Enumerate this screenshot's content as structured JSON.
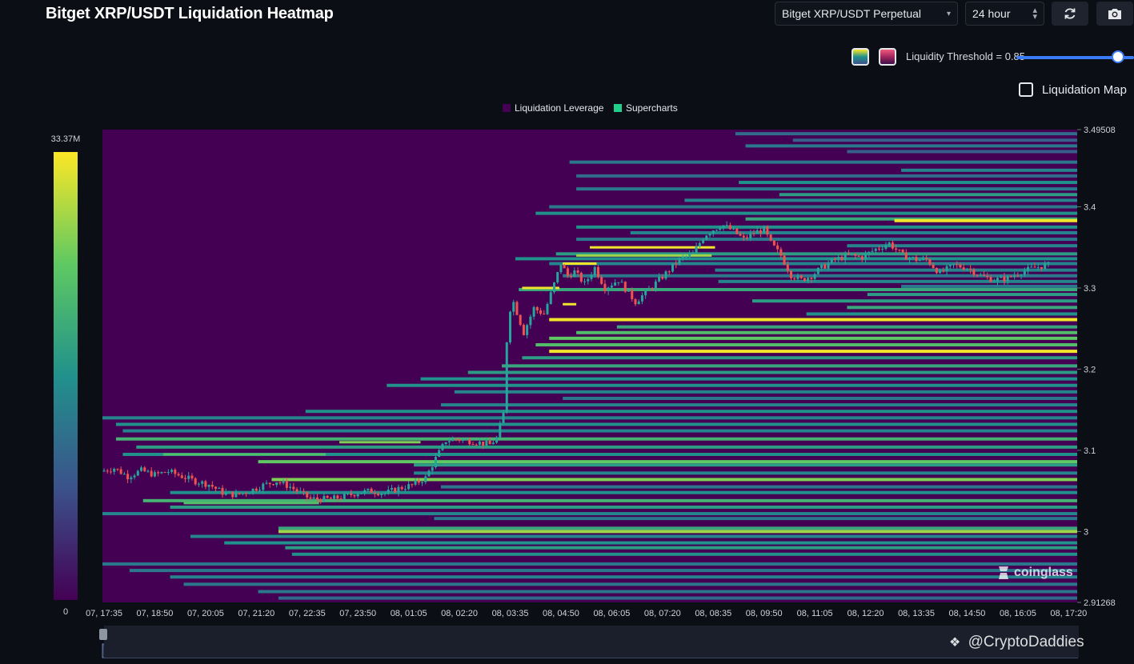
{
  "header": {
    "title": "Bitget XRP/USDT Liquidation Heatmap",
    "pair_select": "Bitget XRP/USDT Perpetual",
    "range_select": "24 hour",
    "threshold_label": "Liquidity Threshold = 0.85",
    "liquidation_map_label": "Liquidation Map"
  },
  "icons": {
    "refresh": "refresh-icon",
    "camera": "camera-icon",
    "dropdown": "chevron-down-icon",
    "stepper": "updown-icon"
  },
  "legend": {
    "leverage": "Liquidation Leverage",
    "supercharts": "Supercharts"
  },
  "colorbar": {
    "max_label": "33.37M",
    "min_label": "0"
  },
  "watermark": "coinglass",
  "credit": "@CryptoDaddies",
  "colors": {
    "background": "#0b0e14",
    "heat_low": "#440154",
    "heat_mid": "#21918c",
    "heat_high": "#fde725",
    "candle_up": "#26a69a",
    "candle_down": "#ef5350",
    "slider": "#3b7bf6"
  },
  "chart_data": {
    "type": "heatmap",
    "title": "Bitget XRP/USDT Liquidation Heatmap",
    "y_ticks": [
      "3.49508",
      "3.4",
      "3.3",
      "3.2",
      "3.1",
      "3",
      "2.91268"
    ],
    "y_tick_values": [
      3.49508,
      3.4,
      3.3,
      3.2,
      3.1,
      3.0,
      2.91268
    ],
    "ylim": [
      2.91268,
      3.49508
    ],
    "x_ticks": [
      "07, 17:35",
      "07, 18:50",
      "07, 20:05",
      "07, 21:20",
      "07, 22:35",
      "07, 23:50",
      "08, 01:05",
      "08, 02:20",
      "08, 03:35",
      "08, 04:50",
      "08, 06:05",
      "08, 07:20",
      "08, 08:35",
      "08, 09:50",
      "08, 11:05",
      "08, 12:20",
      "08, 13:35",
      "08, 14:50",
      "08, 16:05",
      "08, 17:20"
    ],
    "x_minutes": [
      0,
      75,
      150,
      225,
      300,
      375,
      450,
      525,
      600,
      675,
      750,
      825,
      900,
      975,
      1050,
      1125,
      1200,
      1275,
      1350,
      1425
    ],
    "xlim_minutes": [
      0,
      1440
    ],
    "colorbar_range": [
      0,
      33.37
    ],
    "colorbar_unit": "M",
    "price_path": [
      [
        0,
        3.074
      ],
      [
        20,
        3.078
      ],
      [
        40,
        3.068
      ],
      [
        60,
        3.075
      ],
      [
        80,
        3.07
      ],
      [
        100,
        3.074
      ],
      [
        120,
        3.068
      ],
      [
        140,
        3.062
      ],
      [
        160,
        3.058
      ],
      [
        180,
        3.048
      ],
      [
        200,
        3.045
      ],
      [
        220,
        3.05
      ],
      [
        240,
        3.057
      ],
      [
        260,
        3.062
      ],
      [
        280,
        3.055
      ],
      [
        300,
        3.045
      ],
      [
        310,
        3.04
      ],
      [
        320,
        3.04
      ],
      [
        340,
        3.04
      ],
      [
        360,
        3.043
      ],
      [
        380,
        3.048
      ],
      [
        400,
        3.05
      ],
      [
        420,
        3.047
      ],
      [
        440,
        3.053
      ],
      [
        460,
        3.057
      ],
      [
        480,
        3.066
      ],
      [
        495,
        3.09
      ],
      [
        510,
        3.112
      ],
      [
        525,
        3.114
      ],
      [
        550,
        3.111
      ],
      [
        575,
        3.107
      ],
      [
        585,
        3.115
      ],
      [
        595,
        3.145
      ],
      [
        600,
        3.235
      ],
      [
        607,
        3.29
      ],
      [
        615,
        3.27
      ],
      [
        625,
        3.245
      ],
      [
        640,
        3.275
      ],
      [
        655,
        3.268
      ],
      [
        668,
        3.3
      ],
      [
        680,
        3.33
      ],
      [
        690,
        3.315
      ],
      [
        700,
        3.32
      ],
      [
        715,
        3.305
      ],
      [
        730,
        3.325
      ],
      [
        745,
        3.3
      ],
      [
        765,
        3.31
      ],
      [
        790,
        3.283
      ],
      [
        810,
        3.298
      ],
      [
        835,
        3.318
      ],
      [
        855,
        3.335
      ],
      [
        875,
        3.342
      ],
      [
        892,
        3.365
      ],
      [
        905,
        3.372
      ],
      [
        918,
        3.378
      ],
      [
        935,
        3.37
      ],
      [
        950,
        3.36
      ],
      [
        965,
        3.368
      ],
      [
        980,
        3.372
      ],
      [
        990,
        3.355
      ],
      [
        1005,
        3.34
      ],
      [
        1020,
        3.316
      ],
      [
        1035,
        3.31
      ],
      [
        1050,
        3.315
      ],
      [
        1065,
        3.325
      ],
      [
        1085,
        3.335
      ],
      [
        1105,
        3.34
      ],
      [
        1125,
        3.338
      ],
      [
        1145,
        3.348
      ],
      [
        1165,
        3.355
      ],
      [
        1185,
        3.34
      ],
      [
        1205,
        3.335
      ],
      [
        1220,
        3.335
      ],
      [
        1240,
        3.318
      ],
      [
        1260,
        3.328
      ],
      [
        1280,
        3.325
      ],
      [
        1300,
        3.315
      ],
      [
        1320,
        3.31
      ],
      [
        1340,
        3.312
      ],
      [
        1360,
        3.32
      ],
      [
        1380,
        3.325
      ],
      [
        1395,
        3.328
      ]
    ],
    "liquidation_bands": [
      {
        "price": 3.49,
        "start": 935,
        "intensity": 0.35
      },
      {
        "price": 3.482,
        "start": 1020,
        "intensity": 0.3
      },
      {
        "price": 3.475,
        "start": 950,
        "intensity": 0.4
      },
      {
        "price": 3.468,
        "start": 1100,
        "intensity": 0.3
      },
      {
        "price": 3.455,
        "start": 690,
        "intensity": 0.4
      },
      {
        "price": 3.445,
        "start": 1180,
        "intensity": 0.45
      },
      {
        "price": 3.438,
        "start": 700,
        "intensity": 0.35
      },
      {
        "price": 3.43,
        "start": 940,
        "intensity": 0.5
      },
      {
        "price": 3.422,
        "start": 700,
        "intensity": 0.4
      },
      {
        "price": 3.415,
        "start": 1000,
        "intensity": 0.55
      },
      {
        "price": 3.408,
        "start": 860,
        "intensity": 0.45
      },
      {
        "price": 3.4,
        "start": 660,
        "intensity": 0.4
      },
      {
        "price": 3.392,
        "start": 640,
        "intensity": 0.5
      },
      {
        "price": 3.385,
        "start": 950,
        "intensity": 0.6
      },
      {
        "price": 3.383,
        "start": 1170,
        "intensity": 0.98
      },
      {
        "price": 3.375,
        "start": 700,
        "intensity": 0.5
      },
      {
        "price": 3.368,
        "start": 780,
        "intensity": 0.45
      },
      {
        "price": 3.36,
        "start": 700,
        "intensity": 0.4
      },
      {
        "price": 3.352,
        "start": 1100,
        "intensity": 0.45
      },
      {
        "price": 3.342,
        "start": 670,
        "intensity": 0.55
      },
      {
        "price": 3.336,
        "start": 610,
        "intensity": 0.5
      },
      {
        "price": 3.33,
        "start": 660,
        "intensity": 0.45
      },
      {
        "price": 3.322,
        "start": 905,
        "intensity": 0.45
      },
      {
        "price": 3.315,
        "start": 680,
        "intensity": 0.4
      },
      {
        "price": 3.308,
        "start": 910,
        "intensity": 0.45
      },
      {
        "price": 3.302,
        "start": 1180,
        "intensity": 0.4
      },
      {
        "price": 3.298,
        "start": 615,
        "intensity": 0.6
      },
      {
        "price": 3.292,
        "start": 1130,
        "intensity": 0.55
      },
      {
        "price": 3.284,
        "start": 960,
        "intensity": 0.55
      },
      {
        "price": 3.276,
        "start": 1100,
        "intensity": 0.6
      },
      {
        "price": 3.268,
        "start": 1040,
        "intensity": 0.5
      },
      {
        "price": 3.261,
        "start": 660,
        "intensity": 0.98
      },
      {
        "price": 3.252,
        "start": 760,
        "intensity": 0.6
      },
      {
        "price": 3.245,
        "start": 700,
        "intensity": 0.7
      },
      {
        "price": 3.238,
        "start": 660,
        "intensity": 0.75
      },
      {
        "price": 3.23,
        "start": 640,
        "intensity": 0.7
      },
      {
        "price": 3.222,
        "start": 660,
        "intensity": 0.98
      },
      {
        "price": 3.214,
        "start": 620,
        "intensity": 0.55
      },
      {
        "price": 3.204,
        "start": 590,
        "intensity": 0.6
      },
      {
        "price": 3.196,
        "start": 540,
        "intensity": 0.55
      },
      {
        "price": 3.188,
        "start": 470,
        "intensity": 0.5
      },
      {
        "price": 3.18,
        "start": 420,
        "intensity": 0.5
      },
      {
        "price": 3.172,
        "start": 520,
        "intensity": 0.45
      },
      {
        "price": 3.164,
        "start": 680,
        "intensity": 0.4
      },
      {
        "price": 3.156,
        "start": 500,
        "intensity": 0.45
      },
      {
        "price": 3.148,
        "start": 300,
        "intensity": 0.5
      },
      {
        "price": 3.14,
        "start": 0,
        "intensity": 0.45
      },
      {
        "price": 3.132,
        "start": 20,
        "intensity": 0.5
      },
      {
        "price": 3.124,
        "start": 30,
        "intensity": 0.45
      },
      {
        "price": 3.114,
        "start": 20,
        "intensity": 0.65
      },
      {
        "price": 3.104,
        "start": 50,
        "intensity": 0.55
      },
      {
        "price": 3.095,
        "start": 30,
        "intensity": 0.5
      },
      {
        "price": 3.086,
        "start": 230,
        "intensity": 0.75
      },
      {
        "price": 3.082,
        "start": 460,
        "intensity": 0.55
      },
      {
        "price": 3.072,
        "start": 460,
        "intensity": 0.45
      },
      {
        "price": 3.064,
        "start": 250,
        "intensity": 0.8
      },
      {
        "price": 3.055,
        "start": 500,
        "intensity": 0.4
      },
      {
        "price": 3.048,
        "start": 100,
        "intensity": 0.5
      },
      {
        "price": 3.038,
        "start": 60,
        "intensity": 0.65
      },
      {
        "price": 3.03,
        "start": 100,
        "intensity": 0.55
      },
      {
        "price": 3.022,
        "start": 0,
        "intensity": 0.45
      },
      {
        "price": 3.016,
        "start": 490,
        "intensity": 0.4
      },
      {
        "price": 3.004,
        "start": 260,
        "intensity": 0.6
      },
      {
        "price": 3.0,
        "start": 260,
        "intensity": 0.85
      },
      {
        "price": 2.994,
        "start": 130,
        "intensity": 0.45
      },
      {
        "price": 2.986,
        "start": 180,
        "intensity": 0.5
      },
      {
        "price": 2.98,
        "start": 270,
        "intensity": 0.55
      },
      {
        "price": 2.972,
        "start": 280,
        "intensity": 0.5
      },
      {
        "price": 2.96,
        "start": 0,
        "intensity": 0.4
      },
      {
        "price": 2.952,
        "start": 40,
        "intensity": 0.4
      },
      {
        "price": 2.944,
        "start": 100,
        "intensity": 0.45
      },
      {
        "price": 2.935,
        "start": 120,
        "intensity": 0.4
      },
      {
        "price": 2.926,
        "start": 230,
        "intensity": 0.4
      },
      {
        "price": 2.918,
        "start": 260,
        "intensity": 0.35
      }
    ],
    "short_bands": [
      {
        "price": 3.35,
        "start": 720,
        "end": 905,
        "intensity": 0.98
      },
      {
        "price": 3.34,
        "start": 700,
        "end": 900,
        "intensity": 0.85
      },
      {
        "price": 3.33,
        "start": 680,
        "end": 730,
        "intensity": 0.98
      },
      {
        "price": 3.3,
        "start": 620,
        "end": 675,
        "intensity": 0.98
      },
      {
        "price": 3.28,
        "start": 680,
        "end": 700,
        "intensity": 0.98
      },
      {
        "price": 3.11,
        "start": 350,
        "end": 470,
        "intensity": 0.8
      },
      {
        "price": 3.095,
        "start": 90,
        "end": 330,
        "intensity": 0.7
      },
      {
        "price": 3.035,
        "start": 120,
        "end": 320,
        "intensity": 0.7
      }
    ]
  }
}
